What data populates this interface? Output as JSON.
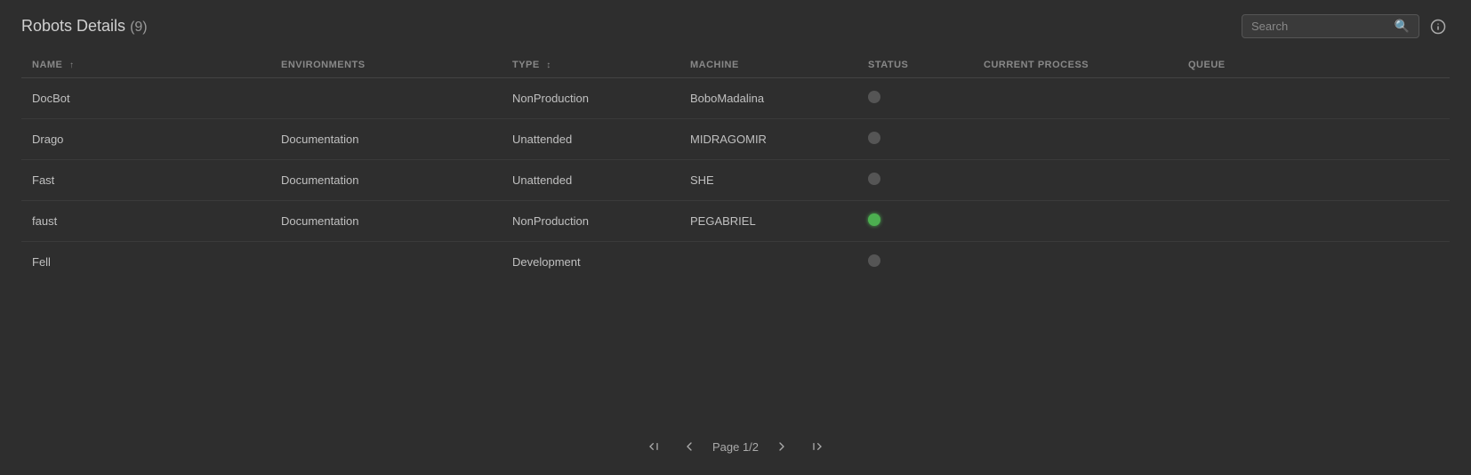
{
  "header": {
    "title": "Robots Details",
    "count": "(9)",
    "search_placeholder": "Search"
  },
  "columns": [
    {
      "key": "name",
      "label": "NAME",
      "sort": "asc"
    },
    {
      "key": "environments",
      "label": "ENVIRONMENTS",
      "sort": null
    },
    {
      "key": "type",
      "label": "TYPE",
      "sort": "sortable"
    },
    {
      "key": "machine",
      "label": "MACHINE",
      "sort": null
    },
    {
      "key": "status",
      "label": "STATUS",
      "sort": null
    },
    {
      "key": "current_process",
      "label": "CURRENT PROCESS",
      "sort": null
    },
    {
      "key": "queue",
      "label": "QUEUE",
      "sort": null
    }
  ],
  "rows": [
    {
      "name": "DocBot",
      "environments": "",
      "type": "NonProduction",
      "machine": "BoboMadalina",
      "status": "inactive",
      "current_process": "",
      "queue": ""
    },
    {
      "name": "Drago",
      "environments": "Documentation",
      "type": "Unattended",
      "machine": "MIDRAGOMIR",
      "status": "inactive",
      "current_process": "",
      "queue": ""
    },
    {
      "name": "Fast",
      "environments": "Documentation",
      "type": "Unattended",
      "machine": "SHE",
      "status": "inactive",
      "current_process": "",
      "queue": ""
    },
    {
      "name": "faust",
      "environments": "Documentation",
      "type": "NonProduction",
      "machine": "PEGABRIEL",
      "status": "active",
      "current_process": "",
      "queue": ""
    },
    {
      "name": "Fell",
      "environments": "",
      "type": "Development",
      "machine": "",
      "status": "inactive",
      "current_process": "",
      "queue": ""
    }
  ],
  "pagination": {
    "label": "Page 1/2",
    "prev_first": "«",
    "prev": "‹",
    "next": "›",
    "next_last": "»"
  },
  "icons": {
    "search": "🔍",
    "info": "ℹ",
    "sort_asc": "↑",
    "sort_both": "↕"
  }
}
